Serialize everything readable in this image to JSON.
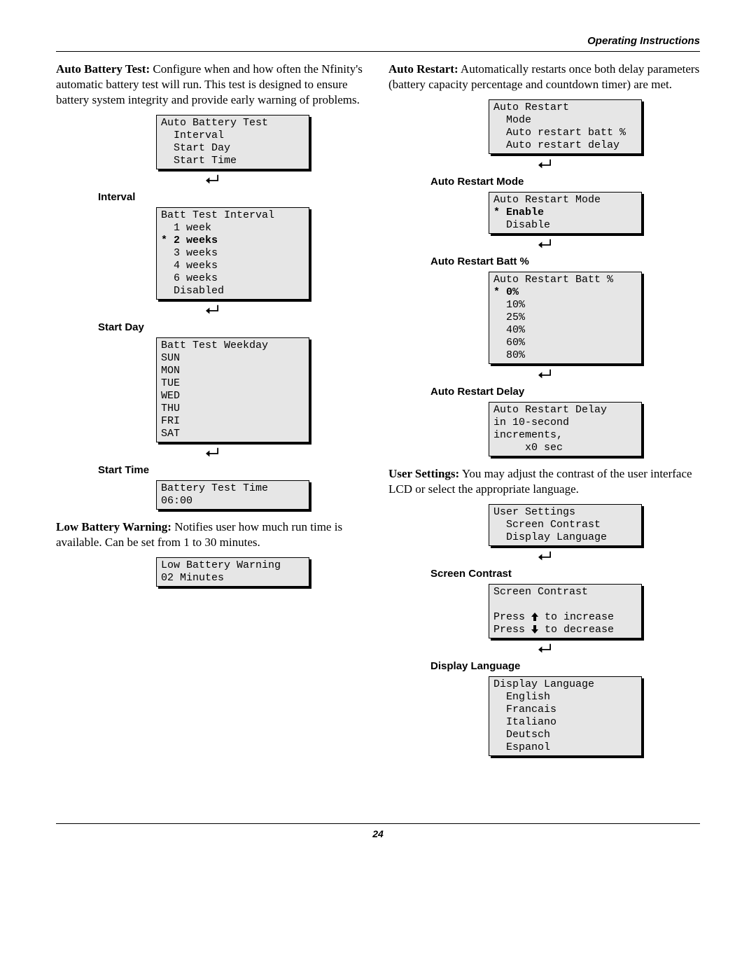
{
  "header": "Operating Instructions",
  "page_num": "24",
  "col1": {
    "p1_bold": "Auto Battery Test:",
    "p1_text": " Configure when and how often the Nfinity's automatic battery test will run. This test is designed to ensure battery system integrity and provide early warning of problems.",
    "lcd1": "Auto Battery Test\n  Interval\n  Start Day\n  Start Time",
    "label_interval": "Interval",
    "lcd2_title": "Batt Test Interval",
    "lcd2_items": [
      "  1 week",
      "  3 weeks",
      "  4 weeks",
      "  6 weeks",
      "  Disabled"
    ],
    "lcd2_sel": "* 2 weeks",
    "label_startday": "Start Day",
    "lcd3": "Batt Test Weekday\nSUN\nMON\nTUE\nWED\nTHU\nFRI\nSAT",
    "label_starttime": "Start Time",
    "lcd4": "Battery Test Time\n06:00",
    "p2_bold": "Low Battery Warning:",
    "p2_text": " Notifies user how much run time is available. Can be set from 1 to 30 minutes.",
    "lcd5": "Low Battery Warning\n02 Minutes"
  },
  "col2": {
    "p1_bold": "Auto Restart:",
    "p1_text": " Automatically restarts once both delay parameters (battery capacity percentage and countdown timer) are met.",
    "lcd1": "Auto Restart\n  Mode\n  Auto restart batt %\n  Auto restart delay",
    "label_mode": "Auto Restart Mode",
    "lcd2_title": "Auto Restart Mode",
    "lcd2_sel": "* Enable",
    "lcd2_items": [
      "  Disable"
    ],
    "label_batt": "Auto Restart Batt %",
    "lcd3_title": "Auto Restart Batt %",
    "lcd3_sel": "* 0%",
    "lcd3_items": [
      "  10%",
      "  25%",
      "  40%",
      "  60%",
      "  80%"
    ],
    "label_delay": "Auto Restart Delay",
    "lcd4": "Auto Restart Delay\nin 10-second\nincrements,\n     x0 sec",
    "p2_bold": "User Settings:",
    "p2_text": " You may adjust the contrast of the user interface LCD or select the appropriate language.",
    "lcd5": "User Settings\n  Screen Contrast\n  Display Language",
    "label_contrast": "Screen Contrast",
    "lcd6_l1": "Screen Contrast",
    "lcd6_l2a": "Press ",
    "lcd6_l2b": " to increase",
    "lcd6_l3a": "Press ",
    "lcd6_l3b": " to decrease",
    "label_lang": "Display Language",
    "lcd7": "Display Language\n  English\n  Francais\n  Italiano\n  Deutsch\n  Espanol"
  }
}
